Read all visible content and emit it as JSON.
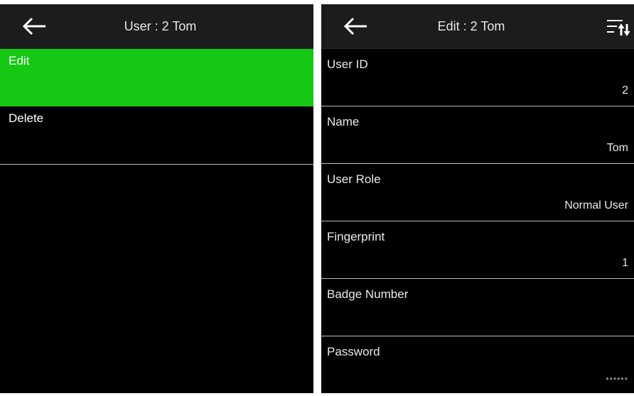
{
  "left_screen": {
    "header": {
      "title": "User : 2 Tom",
      "back_icon": "arrow-left-icon"
    },
    "menu": [
      {
        "label": "Edit",
        "selected": true
      },
      {
        "label": "Delete",
        "selected": false
      }
    ]
  },
  "right_screen": {
    "header": {
      "title": "Edit : 2 Tom",
      "back_icon": "arrow-left-icon",
      "sort_icon": "sort-icon"
    },
    "fields": [
      {
        "label": "User ID",
        "value": "2"
      },
      {
        "label": "Name",
        "value": "Tom"
      },
      {
        "label": "User Role",
        "value": "Normal User"
      },
      {
        "label": "Fingerprint",
        "value": "1"
      },
      {
        "label": "Badge Number",
        "value": ""
      },
      {
        "label": "Password",
        "value": "******"
      }
    ]
  },
  "colors": {
    "header_bg": "#1c1c1c",
    "screen_bg": "#000000",
    "selected_bg": "#14c814",
    "divider": "#bdbdbd",
    "text": "#ffffff"
  }
}
